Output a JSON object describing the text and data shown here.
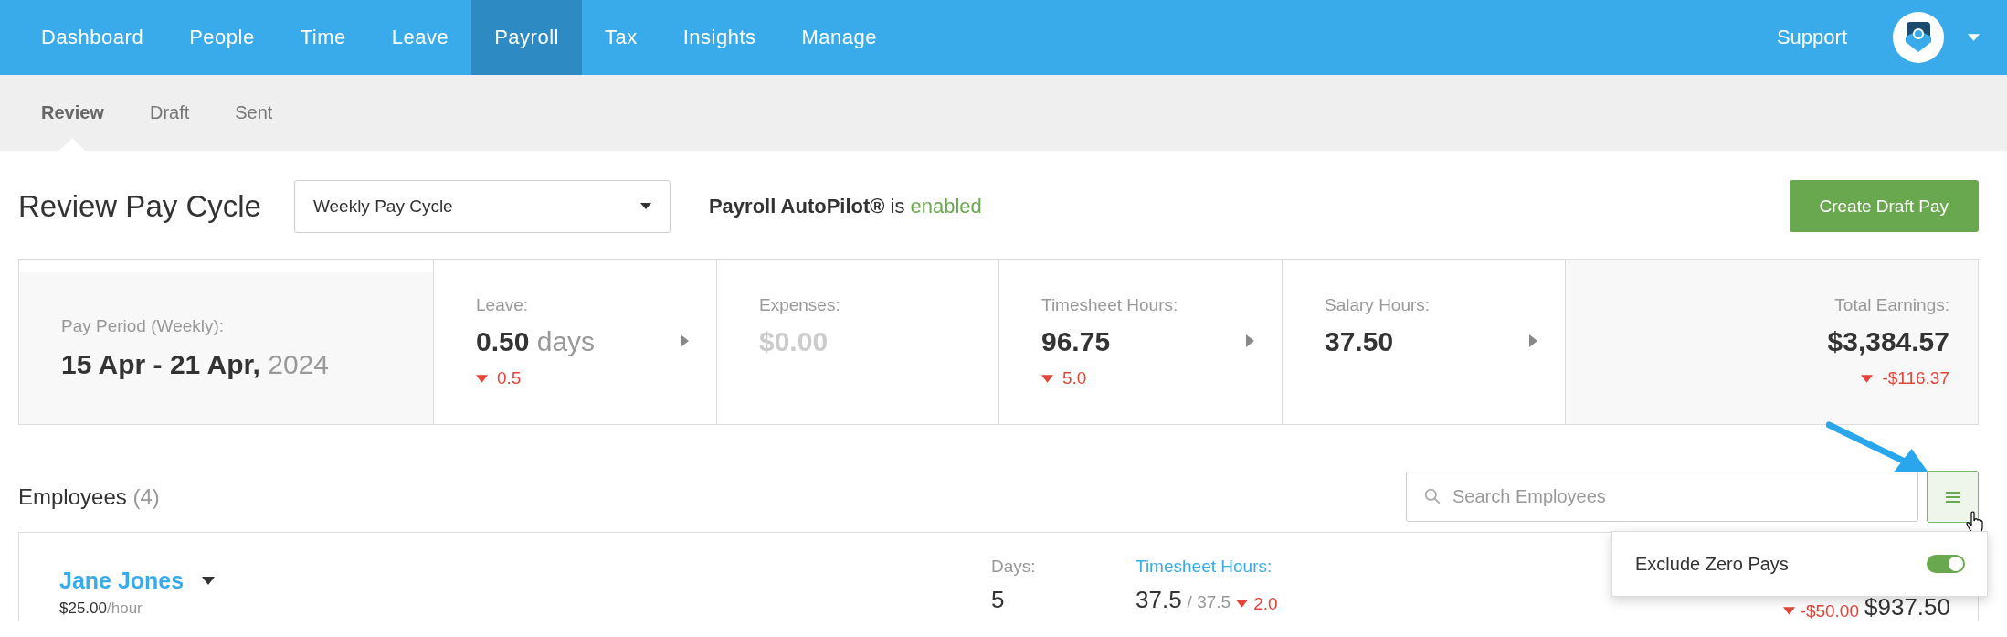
{
  "nav": {
    "items": [
      {
        "label": "Dashboard",
        "selected": false
      },
      {
        "label": "People",
        "selected": false
      },
      {
        "label": "Time",
        "selected": false
      },
      {
        "label": "Leave",
        "selected": false
      },
      {
        "label": "Payroll",
        "selected": true
      },
      {
        "label": "Tax",
        "selected": false
      },
      {
        "label": "Insights",
        "selected": false
      },
      {
        "label": "Manage",
        "selected": false
      }
    ],
    "support": "Support"
  },
  "subnav": [
    {
      "label": "Review",
      "selected": true
    },
    {
      "label": "Draft",
      "selected": false
    },
    {
      "label": "Sent",
      "selected": false
    }
  ],
  "header": {
    "title": "Review Pay Cycle",
    "pay_cycle": "Weekly Pay Cycle",
    "autopilot_name": "Payroll AutoPilot®",
    "autopilot_text": "is",
    "autopilot_status": "enabled",
    "create_button": "Create Draft Pay"
  },
  "summary": [
    {
      "kind": "period",
      "label": "Pay Period (Weekly):",
      "value": "15 Apr - 21 Apr,",
      "suffix": "2024"
    },
    {
      "kind": "metric",
      "label": "Leave:",
      "value": "0.50",
      "suffix": "days",
      "change": "0.5",
      "expandable": true,
      "empty": false
    },
    {
      "kind": "metric",
      "label": "Expenses:",
      "value": "$0.00",
      "expandable": false,
      "empty": true
    },
    {
      "kind": "metric",
      "label": "Timesheet Hours:",
      "value": "96.75",
      "change": "5.0",
      "expandable": true,
      "empty": false
    },
    {
      "kind": "metric",
      "label": "Salary Hours:",
      "value": "37.50",
      "expandable": true,
      "empty": false
    },
    {
      "kind": "total",
      "label": "Total Earnings:",
      "value": "$3,384.57",
      "change": "-$116.37"
    }
  ],
  "employees": {
    "title": "Employees",
    "count": "(4)",
    "search_placeholder": "Search Employees",
    "menu_open": true,
    "menu": {
      "label": "Exclude Zero Pays",
      "on": true
    },
    "rows": [
      {
        "name": "Jane Jones",
        "rate": "$25.00",
        "rate_unit": "/hour",
        "days_label": "Days:",
        "days": "5",
        "hours_label": "Timesheet Hours:",
        "hours": "37.5",
        "hours_total": "/ 37.5",
        "hours_change": "2.0",
        "pay_change": "-$50.00",
        "pay": "$937.50"
      }
    ]
  }
}
